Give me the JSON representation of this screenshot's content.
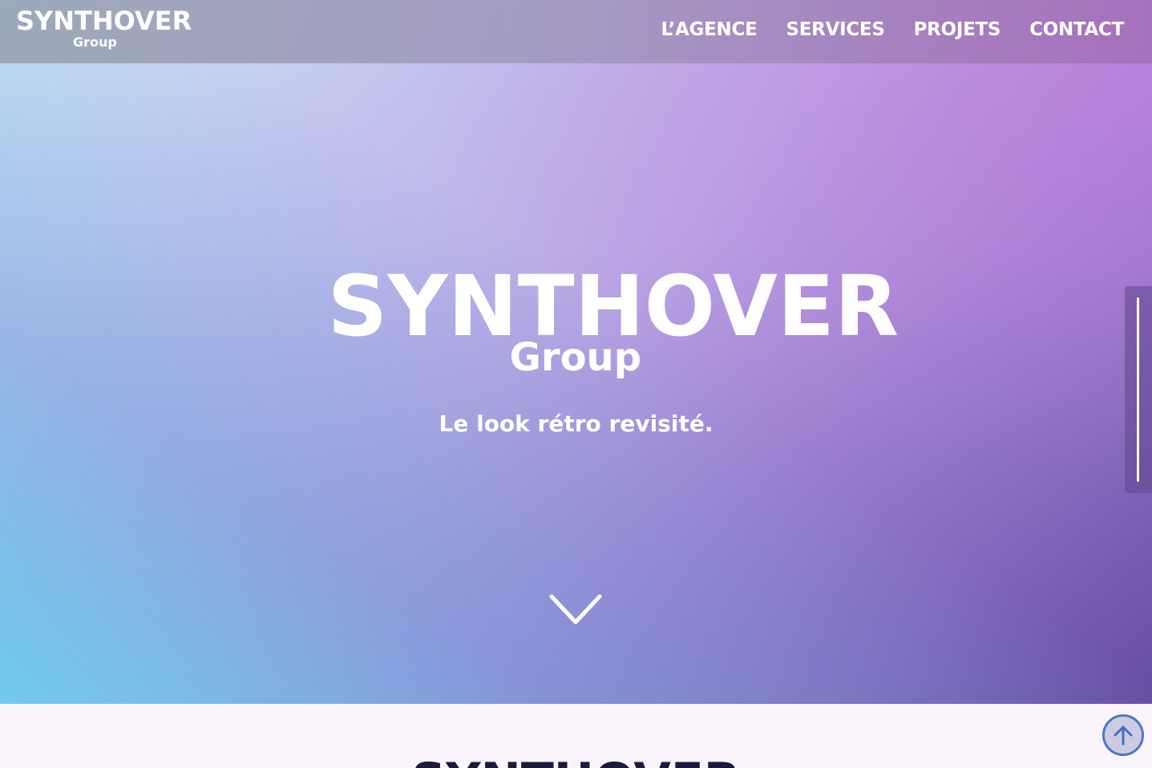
{
  "header": {
    "brand": {
      "main": "SYNTHOVER",
      "sub": "Group"
    },
    "nav": [
      "L’AGENCE",
      "SERVICES",
      "PROJETS",
      "CONTACT"
    ]
  },
  "hero": {
    "logo_main": "SYNTHOVER",
    "logo_sub": "Group",
    "tagline": "Le look rétro revisité."
  },
  "lower": {
    "title": "SYNTHOVER"
  },
  "icons": {
    "scroll_down": "chevron-down-icon",
    "back_to_top": "arrow-up-icon"
  },
  "colors": {
    "text_on_hero": "#ffffff",
    "lower_background": "#fbf4fc",
    "lower_title": "#1b1a3a",
    "back_to_top_border": "#4a78c8"
  }
}
